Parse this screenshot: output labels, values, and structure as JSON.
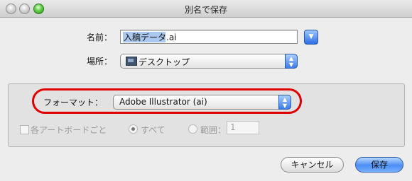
{
  "window": {
    "title": "別名で保存"
  },
  "form": {
    "name_label": "名前：",
    "name_value": "入稿データ.ai",
    "name_selected": "入稿データ",
    "name_ext": ".ai",
    "location_label": "場所：",
    "location_value": "デスクトップ",
    "location_icon": "desktop-folder-icon"
  },
  "options_panel": {
    "format_label": "フォーマット：",
    "format_value": "Adobe Illustrator (ai)",
    "artboards_checkbox_label": "各アートボードごと",
    "artboards_checked": false,
    "radio_all_label": "すべて",
    "radio_range_label": "範囲：",
    "range_value": "1",
    "selected_radio": "すべて",
    "controls_disabled": true
  },
  "buttons": {
    "cancel": "キャンセル",
    "save": "保存"
  },
  "annotation": {
    "highlight_color": "#e00000"
  }
}
